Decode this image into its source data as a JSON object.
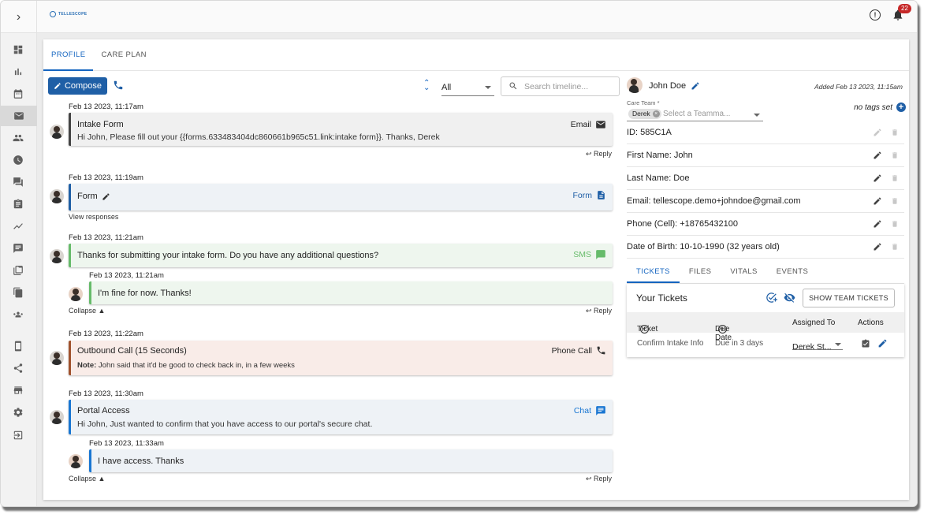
{
  "app": {
    "logo_text": "TELLESCOPE",
    "notification_count": "22"
  },
  "tabs": [
    {
      "label": "PROFILE"
    },
    {
      "label": "CARE PLAN"
    }
  ],
  "toolbar": {
    "compose_label": "Compose",
    "filter_value": "All",
    "search_placeholder": "Search timeline..."
  },
  "timeline": [
    {
      "timestamp": "Feb 13 2023, 11:17am",
      "title": "Intake Form",
      "kind": "Email",
      "body": "Hi John, Please fill out your {{forms.633483404dc860661b965c51.link:intake form}}. Thanks, Derek",
      "reply": "Reply"
    },
    {
      "timestamp": "Feb 13 2023, 11:19am",
      "title": "Form",
      "kind": "Form",
      "link": "View responses"
    },
    {
      "timestamp": "Feb 13 2023, 11:21am",
      "title": "Thanks for submitting your intake form. Do you have any additional questions?",
      "kind": "SMS",
      "response_timestamp": "Feb 13 2023, 11:21am",
      "response": "I'm fine for now. Thanks!",
      "collapse": "Collapse ▲",
      "reply": "Reply"
    },
    {
      "timestamp": "Feb 13 2023, 11:22am",
      "title": "Outbound Call (15 Seconds)",
      "kind": "Phone Call",
      "note_label": "Note:",
      "note": "John said that it'd be good to check back in, in a few weeks"
    },
    {
      "timestamp": "Feb 13 2023, 11:30am",
      "title": "Portal Access",
      "kind": "Chat",
      "body": "Hi John, Just wanted to confirm that you have access to our portal's secure chat.",
      "response_timestamp": "Feb 13 2023, 11:33am",
      "response": "I have access. Thanks",
      "collapse": "Collapse ▲",
      "reply": "Reply"
    }
  ],
  "patient": {
    "name": "John Doe",
    "added": "Added Feb 13 2023, 11:15am",
    "care_team_label": "Care Team *",
    "care_team_chip": "Derek",
    "care_team_placeholder": "Select a Teamma...",
    "tags_text": "no tags set",
    "fields": [
      {
        "label": "ID: 585C1A"
      },
      {
        "label": "First Name: John"
      },
      {
        "label": "Last Name: Doe"
      },
      {
        "label": "Email: tellescope.demo+johndoe@gmail.com"
      },
      {
        "label": "Phone (Cell): +18765432100"
      },
      {
        "label": "Date of Birth: 10-10-1990 (32 years old)"
      }
    ]
  },
  "subtabs": [
    {
      "label": "TICKETS"
    },
    {
      "label": "FILES"
    },
    {
      "label": "VITALS"
    },
    {
      "label": "EVENTS"
    }
  ],
  "tickets": {
    "title": "Your Tickets",
    "show_team_label": "SHOW TEAM TICKETS",
    "headers": {
      "ticket": "Ticket",
      "due": "Due Date",
      "assigned": "Assigned To",
      "actions": "Actions"
    },
    "rows": [
      {
        "ticket": "Confirm Intake Info",
        "due": "Due in 3 days",
        "assigned": "Derek St..."
      }
    ]
  },
  "colors": {
    "primary": "#1f5fa6",
    "email": "#444444",
    "form": "#1f5fa6",
    "sms": "#66bb6a",
    "call": "#a0522d",
    "chat": "#1976d2"
  },
  "sidebar_icons": [
    "dashboard-icon",
    "bar-chart-icon",
    "calendar-icon",
    "mail-icon",
    "people-icon",
    "clock-icon",
    "forum-icon",
    "clipboard-icon",
    "trend-icon",
    "message-icon",
    "folder-icon",
    "copy-icon",
    "groups-icon",
    "device-icon",
    "share-icon",
    "store-icon",
    "gear-icon",
    "logout-icon"
  ]
}
